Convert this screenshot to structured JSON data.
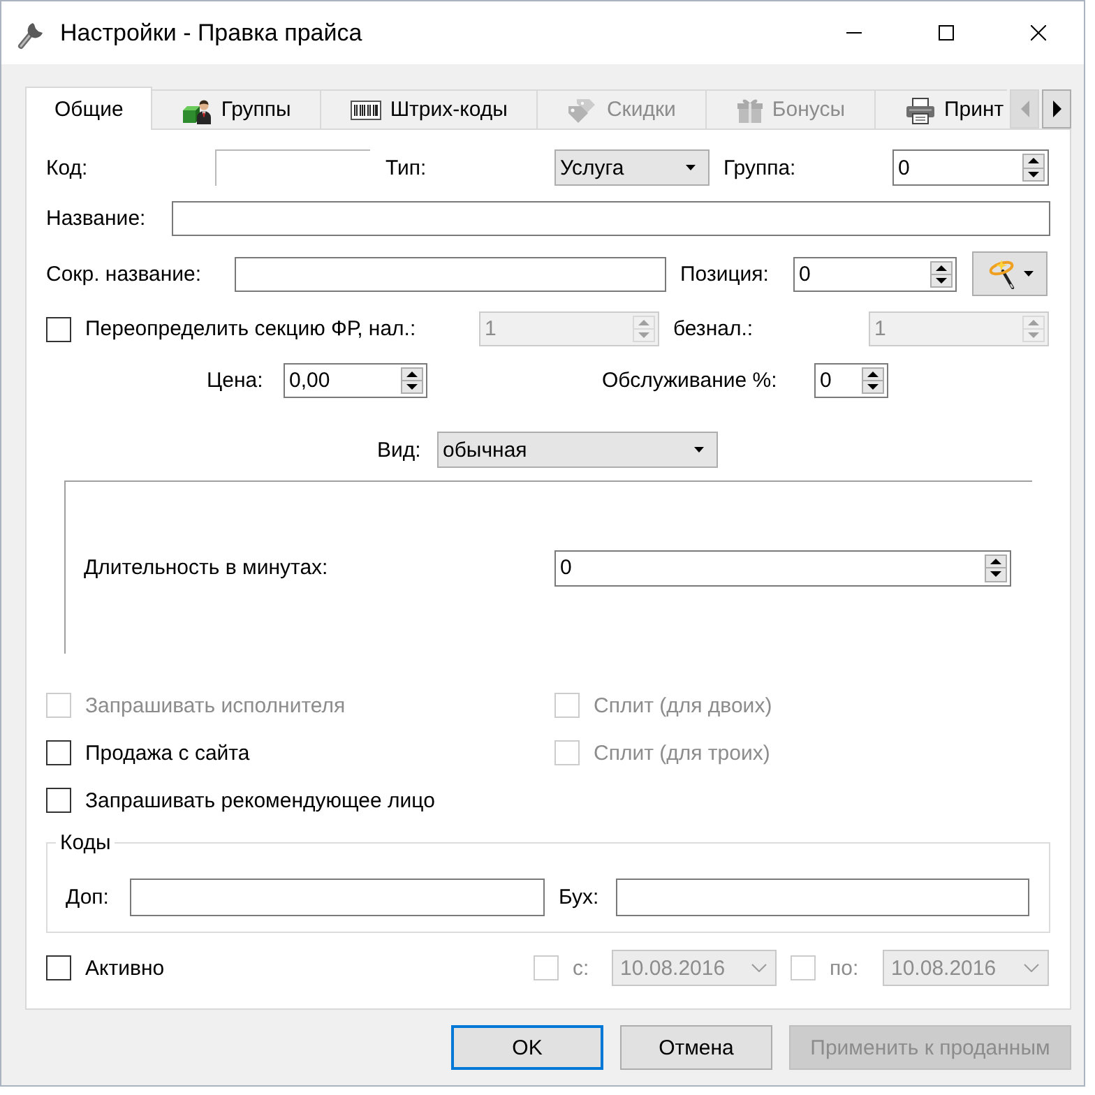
{
  "window": {
    "title": "Настройки - Правка прайса"
  },
  "tabs": [
    {
      "label": "Общие",
      "selected": true,
      "disabled": false
    },
    {
      "label": "Группы",
      "selected": false,
      "disabled": false
    },
    {
      "label": "Штрих-коды",
      "selected": false,
      "disabled": false
    },
    {
      "label": "Скидки",
      "selected": false,
      "disabled": true
    },
    {
      "label": "Бонусы",
      "selected": false,
      "disabled": true
    },
    {
      "label": "Принт",
      "selected": false,
      "disabled": false
    }
  ],
  "tab_scroll": [
    {
      "kind": "back",
      "disabled": true
    },
    {
      "kind": "forward",
      "disabled": false
    }
  ],
  "code": {
    "label": "Код:"
  },
  "type": {
    "label": "Тип:",
    "value": "Услуга"
  },
  "group": {
    "label": "Группа:",
    "value": "0"
  },
  "name": {
    "label": "Название:"
  },
  "short_name": {
    "label": "Сокр. название:"
  },
  "position": {
    "label": "Позиция:",
    "value": "0"
  },
  "fr_section": {
    "label": "Переопределить секцию ФР, нал.:",
    "checked": false,
    "cash": {
      "value": "1",
      "disabled": true
    },
    "noncash_label": "безнал.:",
    "noncash": {
      "value": "1",
      "disabled": true
    }
  },
  "price": {
    "label": "Цена:",
    "value": "0,00"
  },
  "service": {
    "label": "Обслуживание %:",
    "value": "0"
  },
  "view": {
    "label": "Вид:",
    "value": "обычная"
  },
  "duration": {
    "label": "Длительность в минутах:",
    "value": "0"
  },
  "options": [
    {
      "label": "Запрашивать исполнителя",
      "checked": false,
      "disabled": true
    },
    {
      "label": "Сплит (для двоих)",
      "checked": false,
      "disabled": true
    },
    {
      "label": "Продажа с сайта",
      "checked": false,
      "disabled": false
    },
    {
      "label": "Сплит (для троих)",
      "checked": false,
      "disabled": true
    },
    {
      "label": "Запрашивать рекомендующее лицо",
      "checked": false,
      "disabled": false
    }
  ],
  "codes": {
    "title": "Коды",
    "extra": {
      "label": "Доп:"
    },
    "accounting": {
      "label": "Бух:"
    }
  },
  "active": {
    "label": "Активно",
    "checked": false
  },
  "period": [
    {
      "label": "с:",
      "checked": false,
      "disabled": true,
      "value": "10.08.2016"
    },
    {
      "label": "по:",
      "checked": false,
      "disabled": true,
      "value": "10.08.2016"
    }
  ],
  "buttons": [
    {
      "label": "OK",
      "default": true,
      "disabled": false
    },
    {
      "label": "Отмена",
      "default": false,
      "disabled": false
    },
    {
      "label": "Применить к проданным",
      "default": false,
      "disabled": true
    }
  ]
}
